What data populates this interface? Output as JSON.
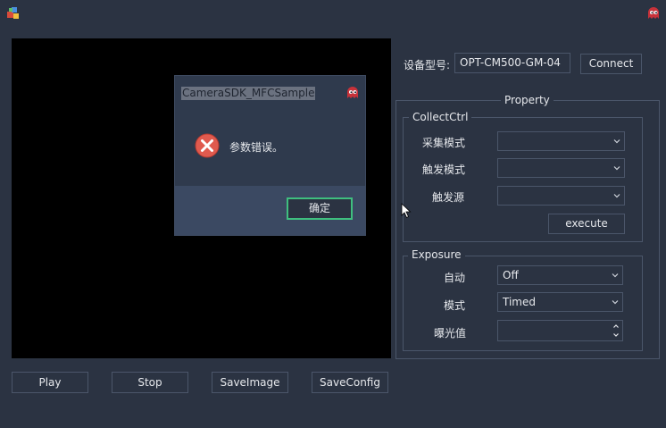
{
  "window": {
    "icon": "app-icon",
    "close_icon": "ghost-close-icon"
  },
  "device": {
    "model_label": "设备型号:",
    "model_value": "OPT-CM500-GM-04",
    "connect_label": "Connect"
  },
  "property": {
    "title": "Property",
    "collect": {
      "title": "CollectCtrl",
      "acq_mode_label": "采集模式",
      "acq_mode_value": "",
      "trigger_mode_label": "触发模式",
      "trigger_mode_value": "",
      "trigger_source_label": "触发源",
      "trigger_source_value": "",
      "execute_label": "execute"
    },
    "exposure": {
      "title": "Exposure",
      "auto_label": "自动",
      "auto_value": "Off",
      "mode_label": "模式",
      "mode_value": "Timed",
      "value_label": "曝光值",
      "value_value": ""
    }
  },
  "toolbar": {
    "play_label": "Play",
    "stop_label": "Stop",
    "save_image_label": "SaveImage",
    "save_config_label": "SaveConfig"
  },
  "dialog": {
    "title": "CameraSDK_MFCSample",
    "message": "参数错误。",
    "ok_label": "确定",
    "icon": "error-icon"
  },
  "colors": {
    "background": "#2b3342",
    "border": "#4b566a",
    "dialog_footer": "#3b4962",
    "error_red": "#e05a4e",
    "focus_green": "#3fbf7f"
  }
}
